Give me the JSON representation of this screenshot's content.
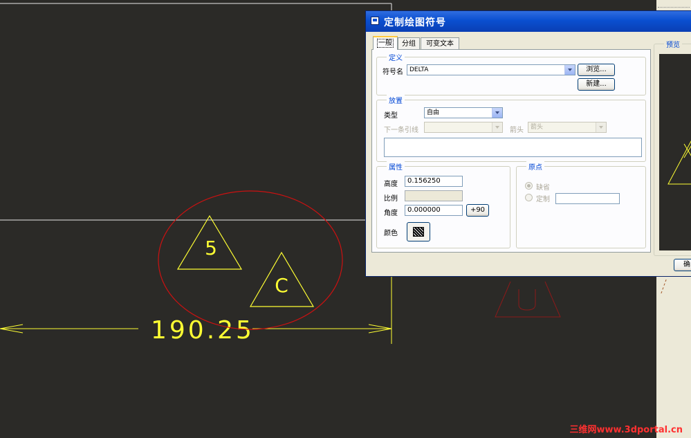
{
  "drawing": {
    "dimension_value": "190.25",
    "symbols": [
      {
        "label": "5"
      },
      {
        "label": "C"
      }
    ]
  },
  "dialog": {
    "title": "定制绘图符号",
    "tabs": [
      "一般",
      "分组",
      "可变文本"
    ],
    "active_tab": "一般",
    "definition": {
      "group_label": "定义",
      "name_label": "符号名",
      "name_value": "DELTA",
      "browse_button": "浏览...",
      "new_button": "新建..."
    },
    "placement": {
      "group_label": "放置",
      "type_label": "类型",
      "type_value": "自由",
      "next_leader_label": "下一条引线",
      "next_leader_value": "",
      "arrow_label": "箭头",
      "arrow_value": "箭头",
      "text_area_value": ""
    },
    "attributes": {
      "group_label": "属性",
      "height_label": "高度",
      "height_value": "0.156250",
      "scale_label": "比例",
      "scale_value": "",
      "angle_label": "角度",
      "angle_value": "0.000000",
      "angle_button": "+90",
      "color_label": "颜色"
    },
    "origin": {
      "group_label": "原点",
      "default_label": "缺省",
      "custom_label": "定制",
      "custom_value": "",
      "selected": "缺省"
    },
    "preview": {
      "group_label": "预览"
    },
    "ok_button": "确"
  },
  "watermark": "三维网www.3dportal.cn",
  "colors": {
    "canvas_bg": "#2b2a27",
    "dimension_yellow": "#ffff33",
    "highlight_ellipse": "#cc1111",
    "preview_symbol_red": "#8b1a1a",
    "title_bar": "#0a4fd0",
    "dialog_bg": "#ece9d8",
    "group_label_blue": "#0046d5"
  }
}
